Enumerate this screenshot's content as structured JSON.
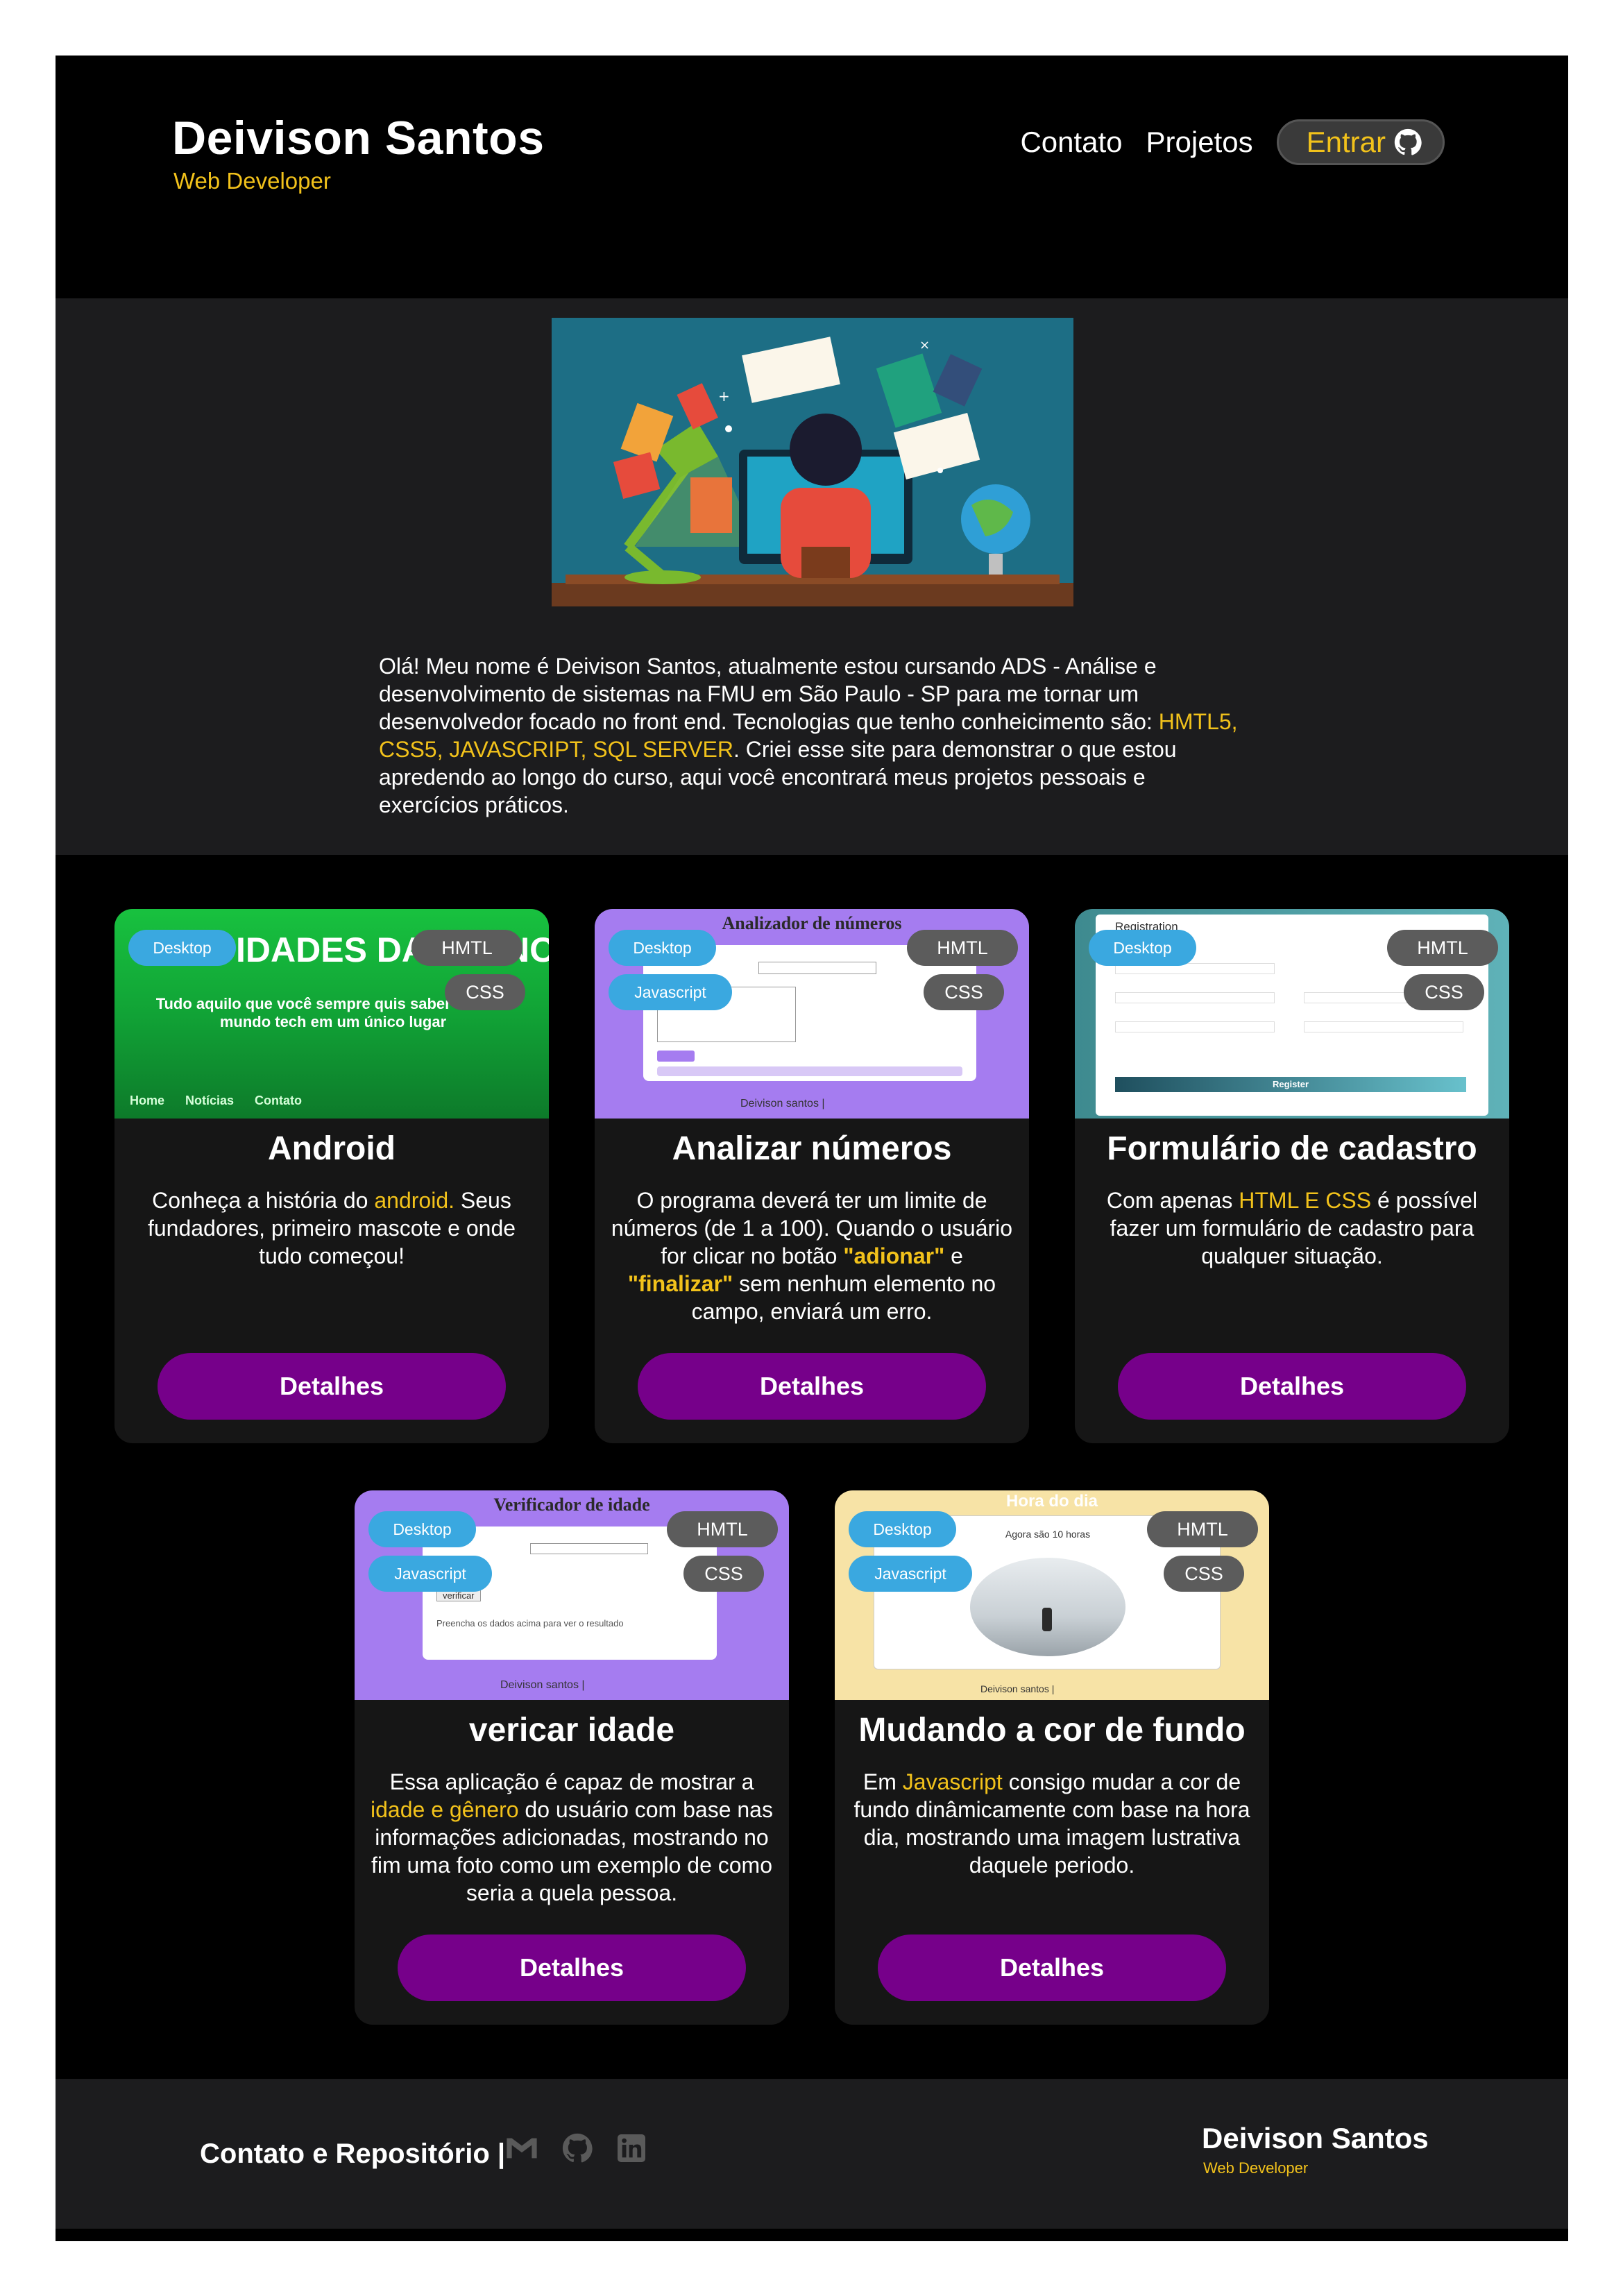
{
  "header": {
    "name": "Deivison Santos",
    "subtitle": "Web Developer",
    "nav": {
      "contact": "Contato",
      "projects": "Projetos",
      "enter": "Entrar"
    }
  },
  "intro": {
    "text_1": "Olá! Meu nome é Deivison Santos, atualmente estou cursando ADS - Análise e desenvolvimento de sistemas na FMU em São Paulo - SP para me tornar um desenvolvedor focado no front end. Tecnologias que tenho conheicimento são: ",
    "highlight": "HMTL5, CSS5, JAVASCRIPT, SQL SERVER",
    "text_2": ". Criei esse site para demonstrar o que estou apredendo ao longo do curso, aqui você encontrará meus projetos pessoais e exercícios práticos."
  },
  "cards": [
    {
      "title": "Android",
      "tags": {
        "device": "Desktop",
        "lang1": "HMTL",
        "lang2": "CSS"
      },
      "thumb": {
        "heading": "IDADES DA TECNOLOGIA",
        "tagline": "Tudo aquilo que você sempre quis saber sobre o mundo tech em um único lugar",
        "nav": [
          "Home",
          "Notícias",
          "Contato"
        ]
      },
      "desc_1": "Conheça a história do ",
      "desc_hl": "android.",
      "desc_2": " Seus fundadores, primeiro mascote e onde tudo começou!",
      "button": "Detalhes"
    },
    {
      "title": "Analizar números",
      "tags": {
        "device": "Desktop",
        "script": "Javascript",
        "lang1": "HMTL",
        "lang2": "CSS"
      },
      "thumb": {
        "heading": "Analizador de números",
        "footer": "Deivison santos |"
      },
      "desc_1": "O programa deverá ter um limite de números (de 1 a 100). Quando o usuário for clicar no botão ",
      "desc_hl": "\"adionar\"",
      "desc_mid": " e ",
      "desc_hl2": "\"finalizar\"",
      "desc_2": " sem nenhum elemento no campo, enviará um erro.",
      "button": "Detalhes"
    },
    {
      "title": "Formulário de cadastro",
      "tags": {
        "device": "Desktop",
        "lang1": "HMTL",
        "lang2": "CSS"
      },
      "thumb": {
        "heading": "Registration",
        "button": "Register"
      },
      "desc_1": "Com apenas ",
      "desc_hl": "HTML E CSS",
      "desc_2": " é possível fazer um formulário de cadastro para qualquer situação.",
      "button": "Detalhes"
    },
    {
      "title": "vericar idade",
      "tags": {
        "device": "Desktop",
        "script": "Javascript",
        "lang1": "HMTL",
        "lang2": "CSS"
      },
      "thumb": {
        "heading": "Verificador de idade",
        "note": "Preencha os dados acima para ver o resultado",
        "button": "verificar",
        "footer": "Deivison santos |"
      },
      "desc_1": "Essa aplicação é capaz de mostrar a ",
      "desc_hl": "idade e gênero",
      "desc_2": " do usuário com base nas informações adicionadas, mostrando no fim uma foto como um exemplo de como seria a quela pessoa.",
      "button": "Detalhes"
    },
    {
      "title": "Mudando a cor de fundo",
      "tags": {
        "device": "Desktop",
        "script": "Javascript",
        "lang1": "HMTL",
        "lang2": "CSS"
      },
      "thumb": {
        "heading": "Hora do dia",
        "time": "Agora são 10 horas",
        "footer": "Deivison santos |"
      },
      "desc_1": "Em ",
      "desc_hl": "Javascript",
      "desc_2": " consigo mudar a cor de fundo dinâmicamente com base na hora dia, mostrando uma imagem lustrativa daquele periodo.",
      "button": "Detalhes"
    }
  ],
  "footer": {
    "label": "Contato e Repositório |",
    "name": "Deivison Santos",
    "subtitle": "Web Developer"
  },
  "colors": {
    "accent": "#f2c21b",
    "button": "#76008a",
    "tag_blue": "#3aa8e0",
    "tag_gray": "#5c5c5c"
  }
}
